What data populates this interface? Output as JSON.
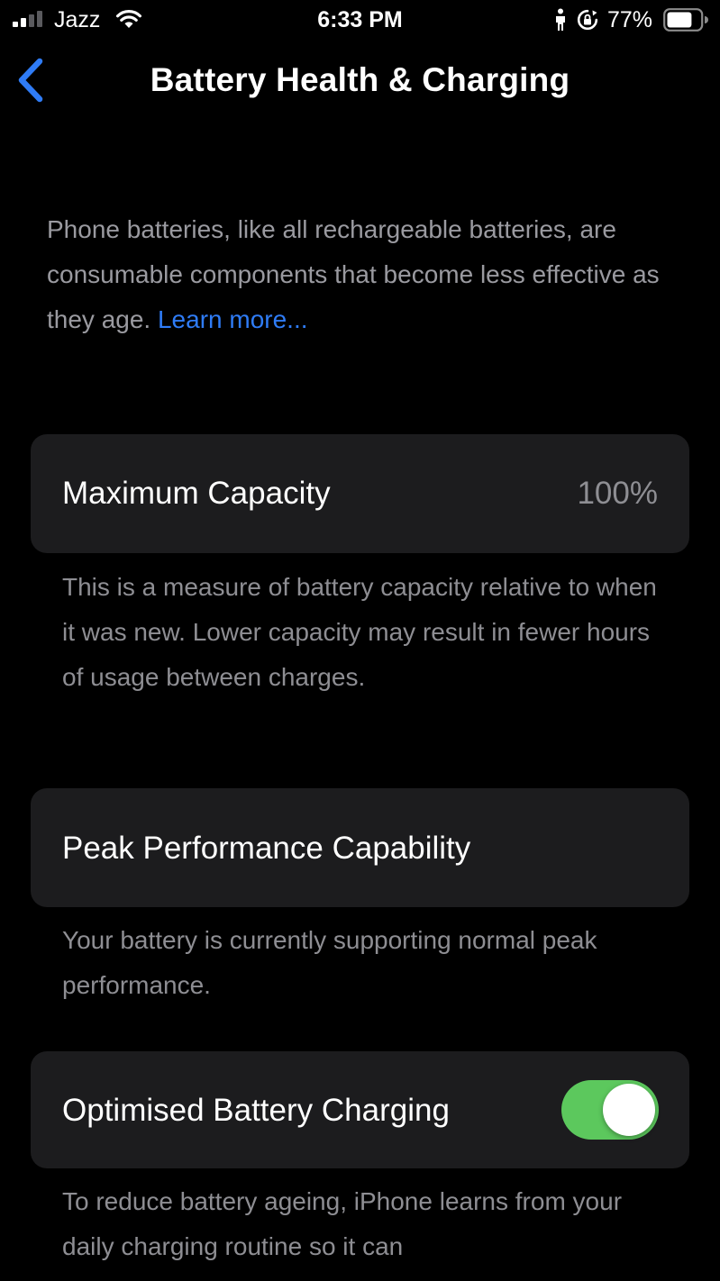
{
  "status_bar": {
    "carrier": "Jazz",
    "time": "6:33 PM",
    "battery_percent": "77%",
    "battery_level": 0.77,
    "signal_bars_filled": 2,
    "signal_bars_total": 4
  },
  "nav": {
    "title": "Battery Health & Charging"
  },
  "intro": {
    "text": "Phone batteries, like all rechargeable batteries, are consumable components that become less effective as they age. ",
    "link": "Learn more..."
  },
  "maximum_capacity": {
    "label": "Maximum Capacity",
    "value": "100%",
    "note": "This is a measure of battery capacity relative to when it was new. Lower capacity may result in fewer hours of usage between charges."
  },
  "peak_performance": {
    "label": "Peak Performance Capability",
    "note": "Your battery is currently supporting normal peak performance."
  },
  "optimised_charging": {
    "label": "Optimised Battery Charging",
    "enabled": true,
    "note": "To reduce battery ageing, iPhone learns from your daily charging routine so it can"
  },
  "colors": {
    "background": "#000000",
    "card": "#1c1c1e",
    "link": "#2f7cf6",
    "toggle_on": "#5cc85d",
    "secondary_text": "#8e8e93"
  }
}
